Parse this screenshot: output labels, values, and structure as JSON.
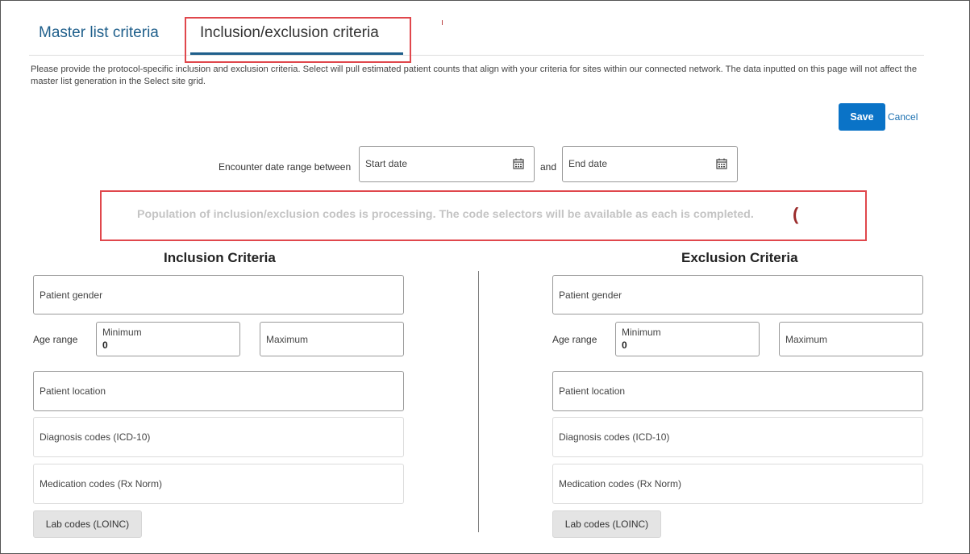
{
  "tabs": {
    "master": "Master list criteria",
    "inclusion_exclusion": "Inclusion/exclusion criteria"
  },
  "description": "Please provide the protocol-specific inclusion and exclusion criteria. Select will pull estimated patient counts that align with your criteria for sites within our connected network. The data inputted on this page will not affect the master list generation in the Select site grid.",
  "actions": {
    "save": "Save",
    "cancel": "Cancel"
  },
  "date_range": {
    "label": "Encounter date range between",
    "start_placeholder": "Start date",
    "connector": "and",
    "end_placeholder": "End date"
  },
  "processing_message": "Population of inclusion/exclusion codes is processing. The code selectors will be available as each is completed.",
  "spinner_glyph": "(",
  "inclusion": {
    "title": "Inclusion Criteria",
    "gender": "Patient gender",
    "age_label": "Age range",
    "min_label": "Minimum",
    "min_value": "0",
    "max_label": "Maximum",
    "location": "Patient location",
    "diagnosis": "Diagnosis codes (ICD-10)",
    "medication": "Medication codes (Rx Norm)",
    "lab": "Lab codes (LOINC)"
  },
  "exclusion": {
    "title": "Exclusion Criteria",
    "gender": "Patient gender",
    "age_label": "Age range",
    "min_label": "Minimum",
    "min_value": "0",
    "max_label": "Maximum",
    "location": "Patient location",
    "diagnosis": "Diagnosis codes (ICD-10)",
    "medication": "Medication codes (Rx Norm)",
    "lab": "Lab codes (LOINC)"
  },
  "colors": {
    "accent": "#1f5f8b",
    "primary_button": "#0a73c7",
    "highlight": "#e0474c"
  }
}
